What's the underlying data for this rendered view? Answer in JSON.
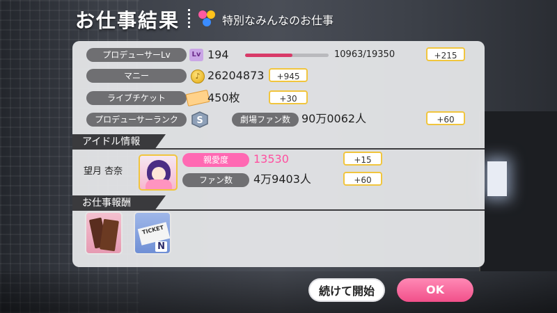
{
  "header": {
    "title": "お仕事結果",
    "subtitle": "特別なみんなのお仕事"
  },
  "stats": {
    "producer_lv": {
      "label": "プロデューサーLv",
      "icon": "Lv",
      "value": "194",
      "exp_text": "10963/19350",
      "exp_fraction": 0.5666,
      "gain": "+215"
    },
    "money": {
      "label": "マニー",
      "value": "26204873",
      "gain": "+945"
    },
    "live_ticket": {
      "label": "ライブチケット",
      "value": "450枚",
      "gain": "+30"
    },
    "producer_rank": {
      "label": "プロデューサーランク",
      "rank_letter": "S"
    },
    "theater_fans": {
      "label": "劇場ファン数",
      "value": "90万0062人",
      "gain": "+60"
    }
  },
  "idol_section": {
    "heading": "アイドル情報",
    "idol_name": "望月 杏奈",
    "affection": {
      "label": "親愛度",
      "value": "13530",
      "gain": "+15"
    },
    "fans": {
      "label": "ファン数",
      "value": "4万9403人",
      "gain": "+60"
    }
  },
  "reward_section": {
    "heading": "お仕事報酬",
    "rewards": [
      {
        "name": "chocolate",
        "icon": "chocolate-icon"
      },
      {
        "name": "ticket",
        "icon": "ticket-icon",
        "rarity": "N",
        "ticket_text": "TICKET"
      }
    ]
  },
  "buttons": {
    "continue": "続けて開始",
    "ok": "OK"
  },
  "colors": {
    "accent_pink": "#f1508a",
    "gain_border": "#f1c53d",
    "exp_bar": "#d83a68"
  }
}
